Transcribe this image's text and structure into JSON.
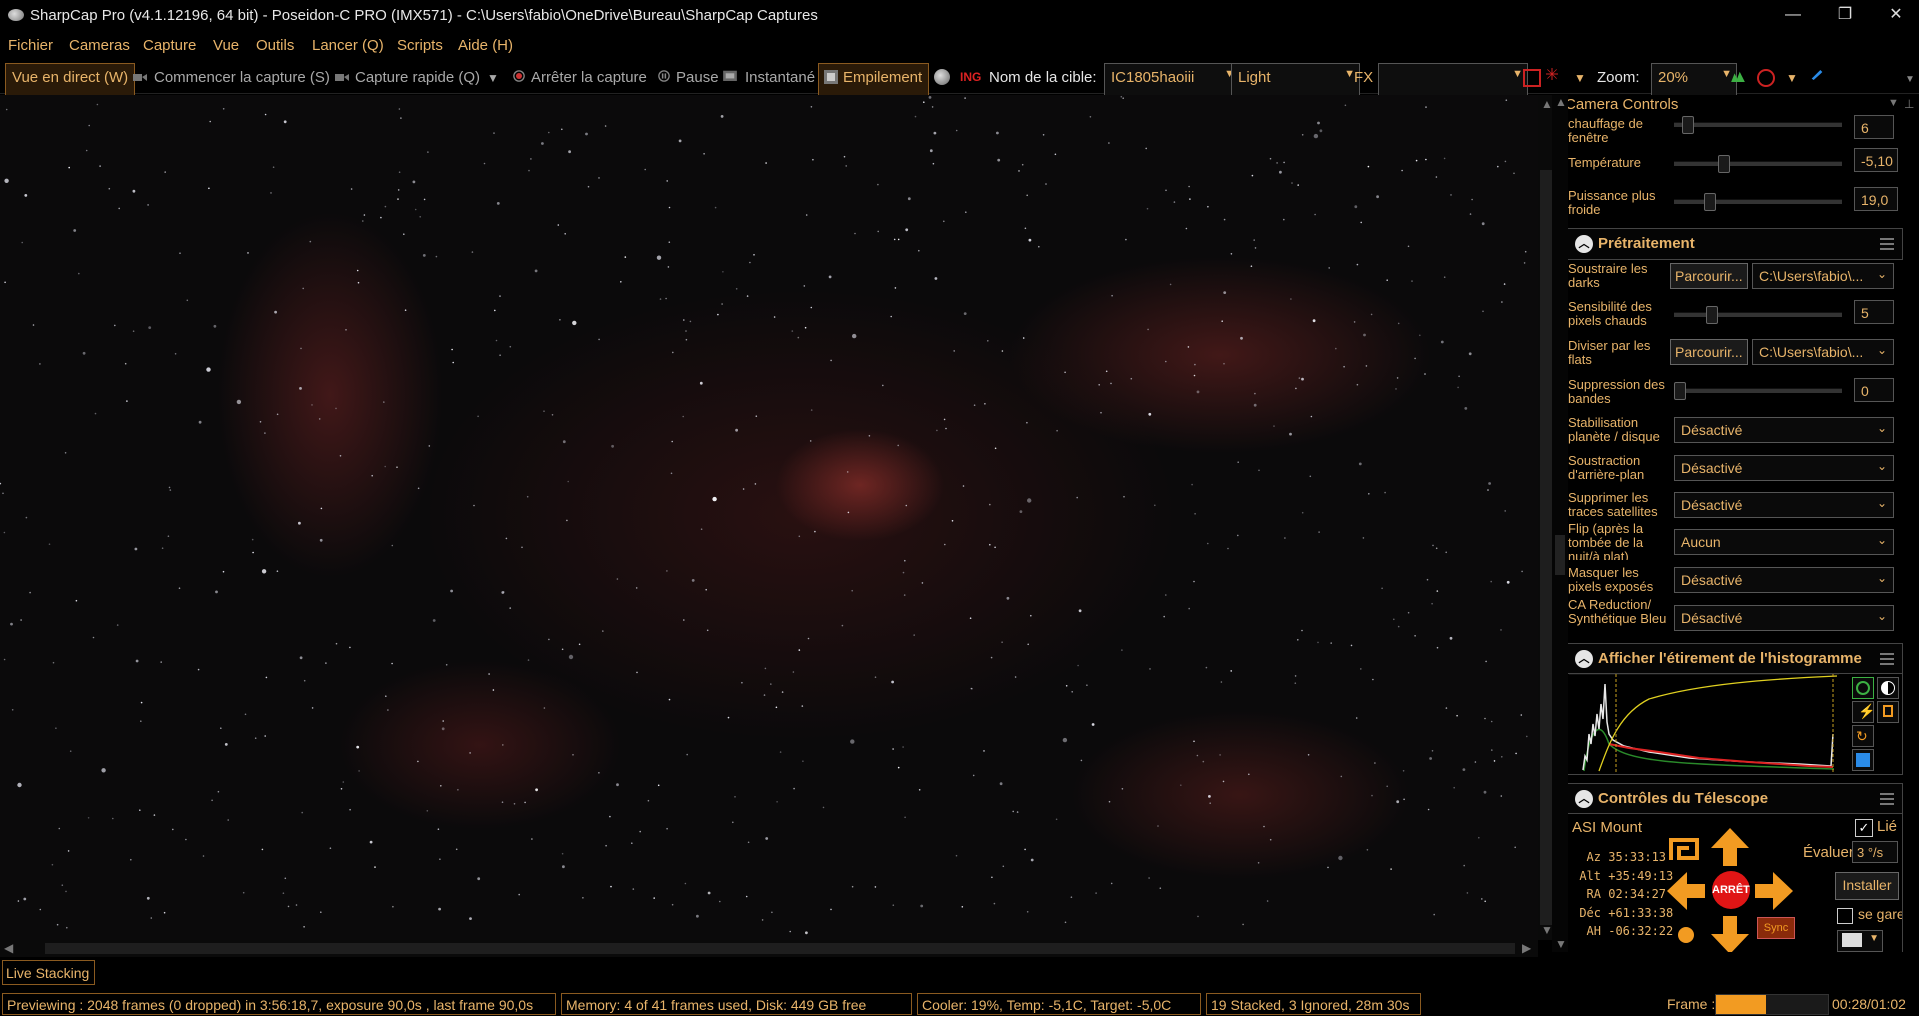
{
  "window": {
    "title": "SharpCap Pro (v4.1.12196, 64 bit) - Poseidon-C PRO (IMX571) - C:\\Users\\fabio\\OneDrive\\Bureau\\SharpCap Captures",
    "minimize": "—",
    "restore": "❐",
    "close": "✕"
  },
  "menu": [
    "Fichier",
    "Cameras",
    "Capture",
    "Vue",
    "Outils",
    "Lancer (Q)",
    "Scripts",
    "Aide (H)"
  ],
  "toolbar": {
    "live_view": "Vue en direct (W)",
    "start_capture": "Commencer la capture (S)",
    "quick_capture": "Capture rapide (Q)",
    "stop_capture": "Arrêter la capture",
    "pause": "Pause",
    "snapshot": "Instantané",
    "stacking": "Empilement",
    "target_label": "Nom de la cible:",
    "target_value": "IC1805haoiii",
    "frame_type": "Light",
    "fx_label": "FX",
    "fx_value": "",
    "zoom_label": "Zoom:",
    "zoom_value": "20%"
  },
  "camera_controls": {
    "title": "Camera Controls",
    "rows": [
      {
        "label": "chauffage de fenêtre",
        "value": "6",
        "pos": 0.05
      },
      {
        "label": "Température",
        "value": "-5,10",
        "pos": 0.28
      },
      {
        "label": "Puissance plus froide",
        "value": "19,0",
        "pos": 0.19
      }
    ]
  },
  "preprocessing": {
    "title": "Prétraitement",
    "darks_label": "Soustraire les darks",
    "browse": "Parcourir...",
    "darks_path": "C:\\Users\\fabio\\...",
    "hotpix_label": "Sensibilité des pixels chauds",
    "hotpix_value": "5",
    "hotpix_pos": 0.2,
    "flats_label": "Diviser par les flats",
    "flats_path": "C:\\Users\\fabio\\...",
    "banding_label": "Suppression des bandes",
    "banding_value": "0",
    "banding_pos": 0.0,
    "dropdowns": [
      {
        "label": "Stabilisation planète / disque",
        "value": "Désactivé"
      },
      {
        "label": "Soustraction d'arrière-plan",
        "value": "Désactivé"
      },
      {
        "label": "Supprimer les traces satellites",
        "value": "Désactivé"
      },
      {
        "label": "Flip (après la tombée de la nuit/à plat)",
        "value": "Aucun"
      },
      {
        "label": "Masquer les pixels exposés",
        "value": "Désactivé"
      },
      {
        "label": "CA Reduction/ Synthétique Bleu",
        "value": "Désactivé"
      }
    ]
  },
  "histogram": {
    "title": "Afficher l'étirement de l'histogramme"
  },
  "telescope": {
    "title": "Contrôles du Télescope",
    "mount": "ASI Mount",
    "linked_label": "Lié",
    "linked": true,
    "coords": [
      {
        "k": "Az",
        "v": "35:33:13"
      },
      {
        "k": "Alt",
        "v": "+35:49:13"
      },
      {
        "k": "RA",
        "v": "02:34:27"
      },
      {
        "k": "Déc",
        "v": "+61:33:38"
      },
      {
        "k": "AH",
        "v": "-06:32:22"
      }
    ],
    "rate_label": "Évaluer:",
    "rate_value": "3 °/s",
    "install": "Installer",
    "stop": "ARRÊTE",
    "park_label": "se garer"
  },
  "bottom": {
    "live_stacking": "Live Stacking",
    "status": [
      "Previewing : 2048 frames (0 dropped) in 3:56:18,7, exposure 90,0s , last frame 90,0s",
      "Memory: 4 of 41 frames used, Disk: 449 GB free",
      "Cooler: 19%, Temp: -5,1C, Target: -5,0C",
      "19 Stacked, 3 Ignored, 28m 30s"
    ],
    "frame_label": "Frame :",
    "frame_time": "00:28/01:02",
    "frame_progress": 0.45
  },
  "colors": {
    "accent": "#e8b46a",
    "orange_btn": "#f29b22",
    "stop_red": "#e01515"
  }
}
